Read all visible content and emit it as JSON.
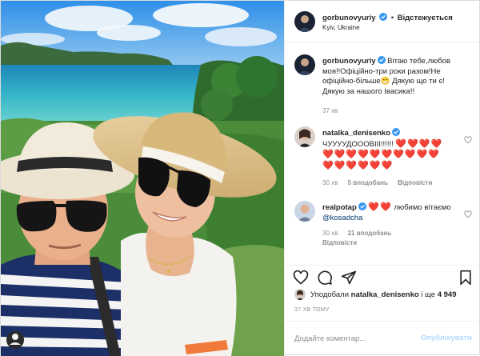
{
  "header": {
    "username": "gorbunovyuriy",
    "follow_state": "Відстежується",
    "location": "Kyiv, Ukraine"
  },
  "caption": {
    "username": "gorbunovyuriy",
    "text": "Вітаю тебе,любов моя!!Офіційно-три роки разом!Не офіційно-більше😁 Дякую що ти є! Дякую за нашого Івасика!!",
    "time": "37 хв"
  },
  "comments": [
    {
      "username": "natalka_denisenko",
      "text": "ЧУУУУДОООВІІІ!!!!!!",
      "hearts_line1": "❤️❤️❤️❤️",
      "hearts_line2": "❤️❤️❤️❤️❤️❤️❤️❤️❤️❤️",
      "hearts_line3": "❤️❤️❤️❤️❤️❤️",
      "time": "30 хв",
      "likes": "5 вподобань",
      "reply": "Відповісти"
    },
    {
      "username": "realpotap",
      "hearts": "❤️❤️",
      "text": " любимо вітаємо ",
      "mention": "@kosadcha",
      "time": "30 хв",
      "likes": "21 вподобань",
      "reply": "Відповісти"
    }
  ],
  "likes": {
    "prefix": "Уподобали ",
    "user": "natalka_denisenko",
    "middle": " і ще ",
    "count": "4 949"
  },
  "post_time": "37 ХВ ТОМУ",
  "add_comment": {
    "placeholder": "Додайте коментар...",
    "publish": "Опублікувати"
  },
  "colors": {
    "accent": "#0095f6",
    "publish_disabled": "#b3dbff",
    "verified": "#3897f0",
    "heart": "#ed1b24"
  },
  "icons": [
    "heart-icon",
    "comment-icon",
    "share-icon",
    "bookmark-icon",
    "verified-icon"
  ]
}
